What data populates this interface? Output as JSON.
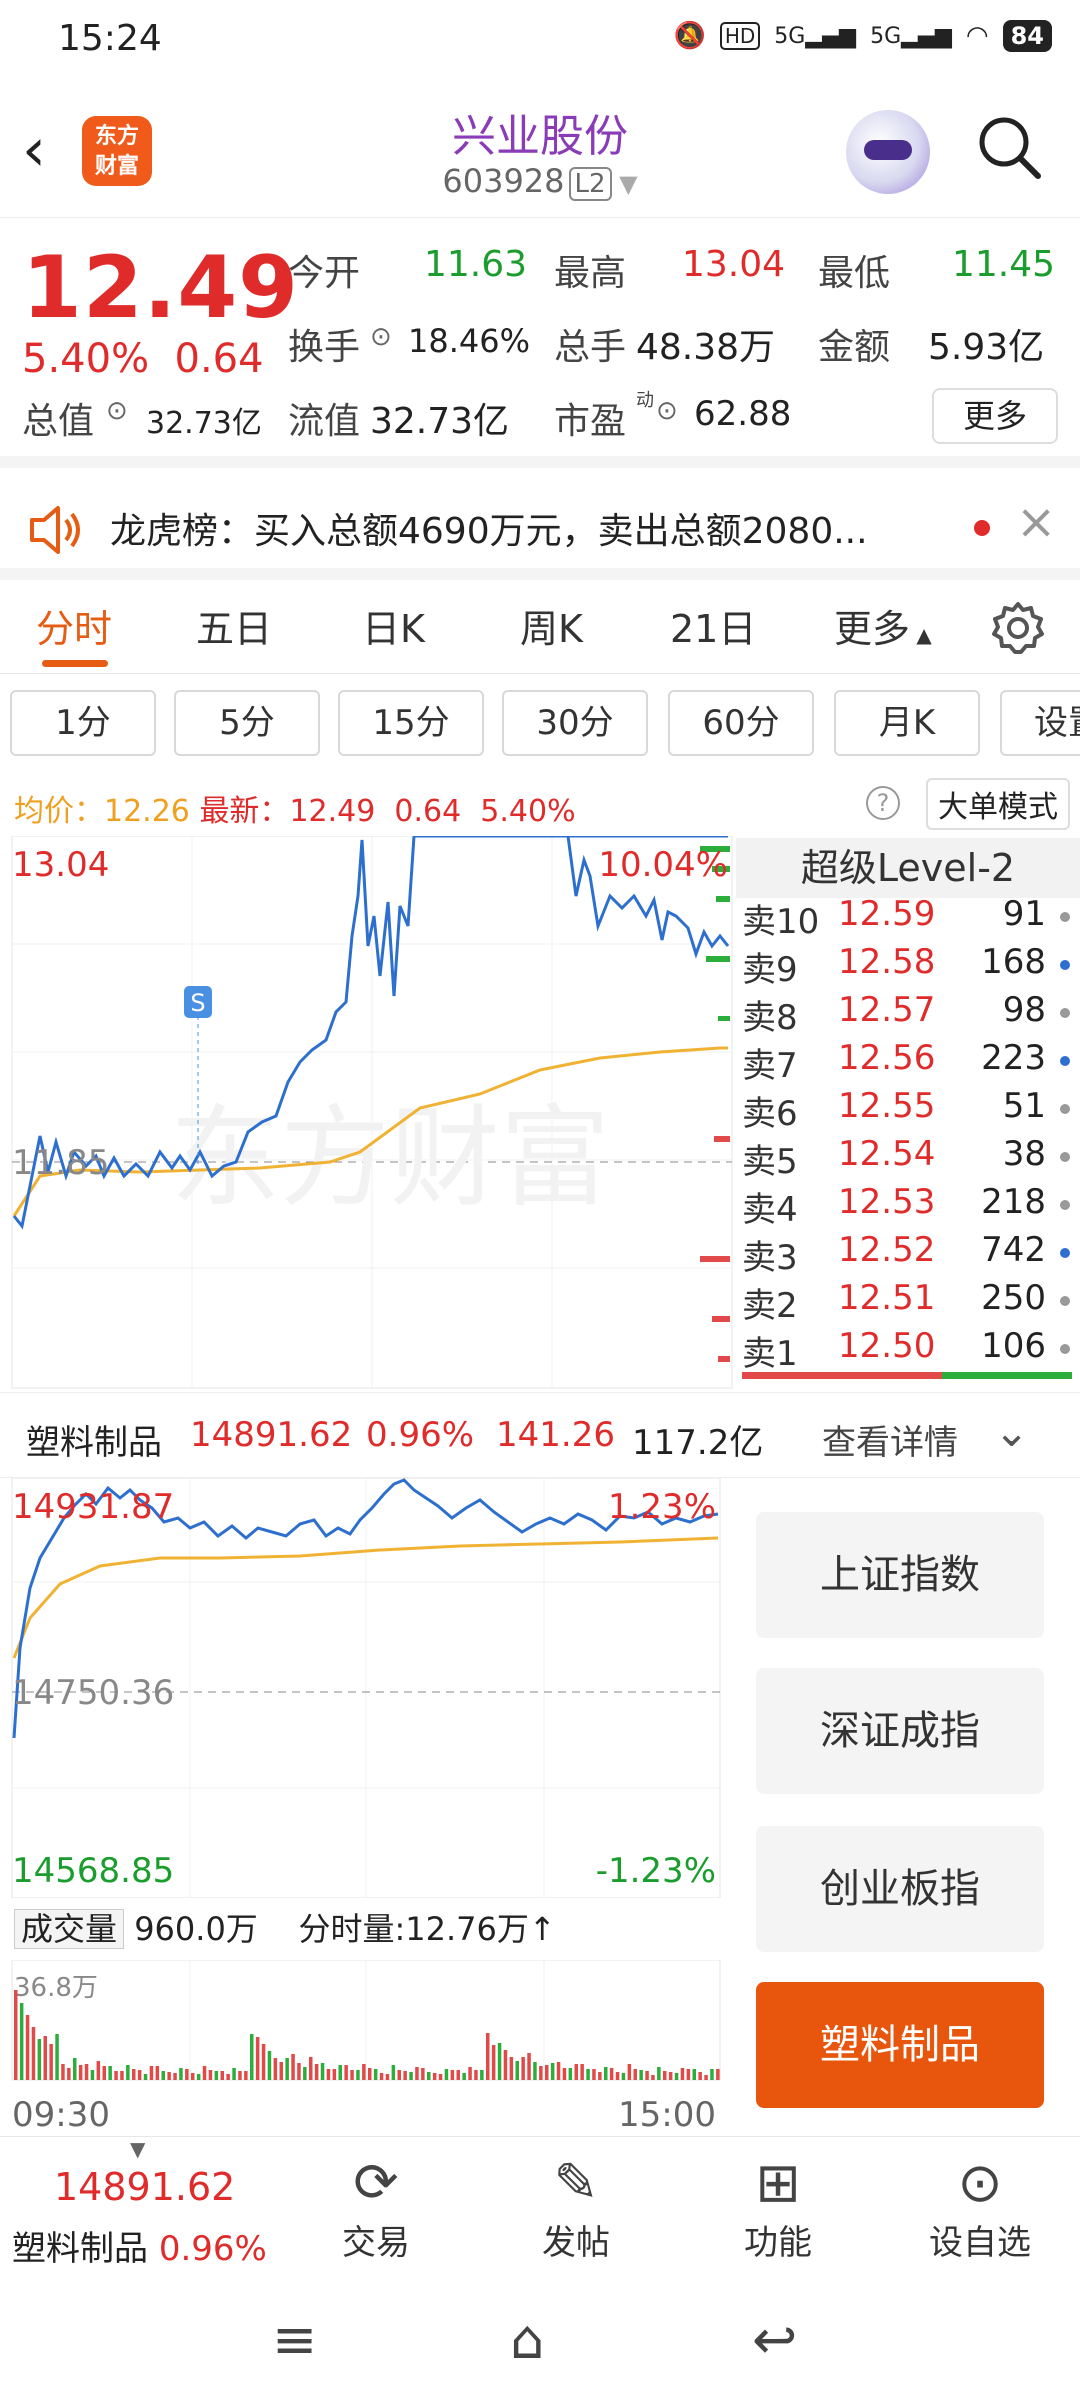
{
  "status_bar": {
    "time": "15:24",
    "battery": "84",
    "signal_1": "5G",
    "signal_2": "5G",
    "hd": "HD"
  },
  "header": {
    "logo_line1": "东方",
    "logo_line2": "财富",
    "stock_name": "兴业股份",
    "stock_code": "603928",
    "level_badge": "L2"
  },
  "quote": {
    "price": "12.49",
    "change_pct": "5.40%",
    "change_abs": "0.64",
    "open_label": "今开",
    "open": "11.63",
    "high_label": "最高",
    "high": "13.04",
    "low_label": "最低",
    "low": "11.45",
    "turnover_label": "换手",
    "turnover": "18.46%",
    "volume_label": "总手",
    "volume": "48.38万",
    "amount_label": "金额",
    "amount": "5.93亿",
    "mktcap_label": "总值",
    "mktcap": "32.73亿",
    "float_label": "流值",
    "float": "32.73亿",
    "pe_label": "市盈",
    "pe_sup": "动",
    "pe": "62.88",
    "more_button": "更多"
  },
  "notice": {
    "text": "龙虎榜：买入总额4690万元，卖出总额2080..."
  },
  "tabs": [
    "分时",
    "五日",
    "日K",
    "周K",
    "21日",
    "更多"
  ],
  "intervals": [
    "1分",
    "5分",
    "15分",
    "30分",
    "60分",
    "月K",
    "设置"
  ],
  "avg_line": {
    "avg_label": "均价：",
    "avg": "12.26",
    "latest_label": "最新：",
    "latest": "12.49",
    "chg": "0.64",
    "pct": "5.40%",
    "big_order_mode": "大单模式"
  },
  "main_chart": {
    "top_price": "13.04",
    "top_pct": "10.04%",
    "mid_price": "11.85",
    "marker": "S",
    "watermark": "东方财富"
  },
  "orderbook": {
    "title": "超级Level-2",
    "rows": [
      {
        "label": "卖10",
        "price": "12.59",
        "vol": "91",
        "dot": "#999999"
      },
      {
        "label": "卖9",
        "price": "12.58",
        "vol": "168",
        "dot": "#2d6fcf"
      },
      {
        "label": "卖8",
        "price": "12.57",
        "vol": "98",
        "dot": "#999999"
      },
      {
        "label": "卖7",
        "price": "12.56",
        "vol": "223",
        "dot": "#2d6fcf"
      },
      {
        "label": "卖6",
        "price": "12.55",
        "vol": "51",
        "dot": "#999999"
      },
      {
        "label": "卖5",
        "price": "12.54",
        "vol": "38",
        "dot": "#999999"
      },
      {
        "label": "卖4",
        "price": "12.53",
        "vol": "218",
        "dot": "#999999"
      },
      {
        "label": "卖3",
        "price": "12.52",
        "vol": "742",
        "dot": "#2d6fcf"
      },
      {
        "label": "卖2",
        "price": "12.51",
        "vol": "250",
        "dot": "#999999"
      },
      {
        "label": "卖1",
        "price": "12.50",
        "vol": "106",
        "dot": "#999999"
      }
    ]
  },
  "sector": {
    "name": "塑料制品",
    "value": "14891.62",
    "pct": "0.96%",
    "chg": "141.26",
    "amount": "117.2亿",
    "details": "查看详情"
  },
  "sector_chart": {
    "top": "14931.87",
    "top_pct": "1.23%",
    "mid": "14750.36",
    "bottom": "14568.85",
    "bottom_pct": "-1.23%"
  },
  "side_buttons": [
    "上证指数",
    "深证成指",
    "创业板指",
    "塑料制品"
  ],
  "volume": {
    "label": "成交量",
    "total": "960.0万",
    "minute_label": "分时量:12.76万",
    "arrow": "↑",
    "max": "36.8万",
    "start_time": "09:30",
    "end_time": "15:00"
  },
  "bottom_bar": {
    "sector_value": "14891.62",
    "sector_name": "塑料制品",
    "sector_pct": "0.96%",
    "items": [
      "交易",
      "发帖",
      "功能",
      "设自选"
    ]
  },
  "colors": {
    "up": "#e02b2b",
    "down": "#1a9d2c",
    "accent": "#e65c12",
    "price_line": "#2d6fcf",
    "avg_line": "#f0b232"
  }
}
